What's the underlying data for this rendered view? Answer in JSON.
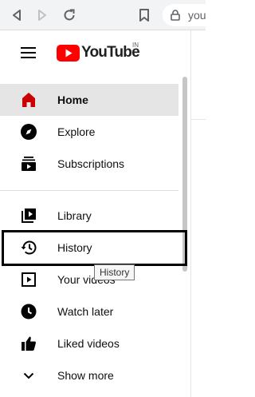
{
  "browser": {
    "url_text": "you"
  },
  "header": {
    "logo_text": "YouTube",
    "region_code": "IN"
  },
  "sidebar": {
    "items": [
      {
        "label": "Home",
        "icon": "home-icon",
        "active": true
      },
      {
        "label": "Explore",
        "icon": "compass-icon"
      },
      {
        "label": "Subscriptions",
        "icon": "subscriptions-icon"
      },
      {
        "label": "Library",
        "icon": "library-icon"
      },
      {
        "label": "History",
        "icon": "history-icon",
        "highlighted": true
      },
      {
        "label": "Your videos",
        "icon": "your-videos-icon"
      },
      {
        "label": "Watch later",
        "icon": "clock-icon"
      },
      {
        "label": "Liked videos",
        "icon": "thumbs-up-icon"
      },
      {
        "label": "Show more",
        "icon": "chevron-down-icon"
      }
    ]
  },
  "tooltip": {
    "text": "History"
  },
  "colors": {
    "brand_red": "#ff0000",
    "active_bg": "#e5e5e5",
    "icon": "#030303"
  }
}
